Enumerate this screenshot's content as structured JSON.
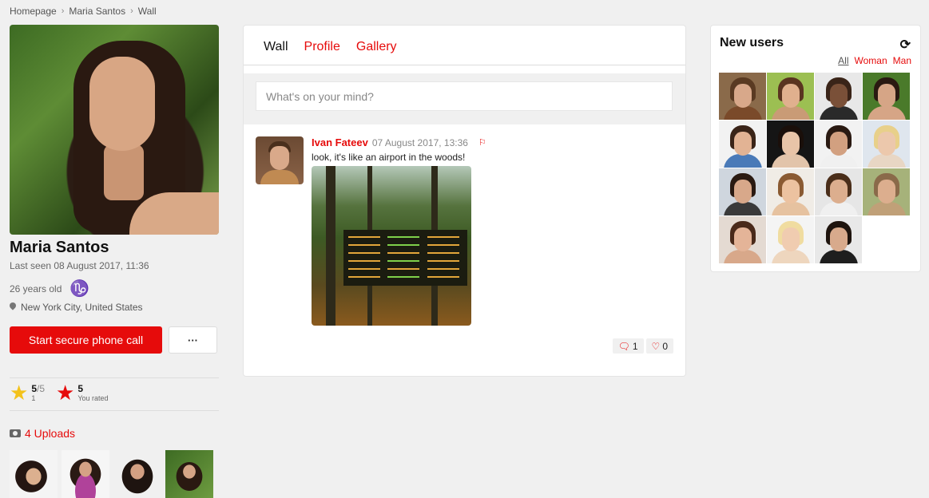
{
  "breadcrumb": [
    "Homepage",
    "Maria Santos",
    "Wall"
  ],
  "profile": {
    "name": "Maria Santos",
    "last_seen": "Last seen 08 August 2017, 11:36",
    "age": "26 years old",
    "zodiac_symbol": "♑",
    "location": "New York City, United States",
    "call_button": "Start secure phone call",
    "more_button": "···",
    "rating": {
      "value": "5",
      "max": "/5",
      "count": "1"
    },
    "your_rating": {
      "value": "5",
      "label": "You rated"
    },
    "uploads_label": "4 Uploads"
  },
  "wall": {
    "tabs": [
      "Wall",
      "Profile",
      "Gallery"
    ],
    "composer_placeholder": "What's on your mind?",
    "post": {
      "author": "Ivan Fateev",
      "time": "07 August 2017, 13:36",
      "text": "look, it's like an airport in the woods!",
      "comments": "1",
      "likes": "0"
    }
  },
  "new_users": {
    "title": "New users",
    "filters": {
      "all": "All",
      "woman": "Woman",
      "man": "Man"
    }
  },
  "colors": {
    "accent": "#e60b0b",
    "star": "#f3c21b",
    "zodiac": "#3ca41c"
  }
}
